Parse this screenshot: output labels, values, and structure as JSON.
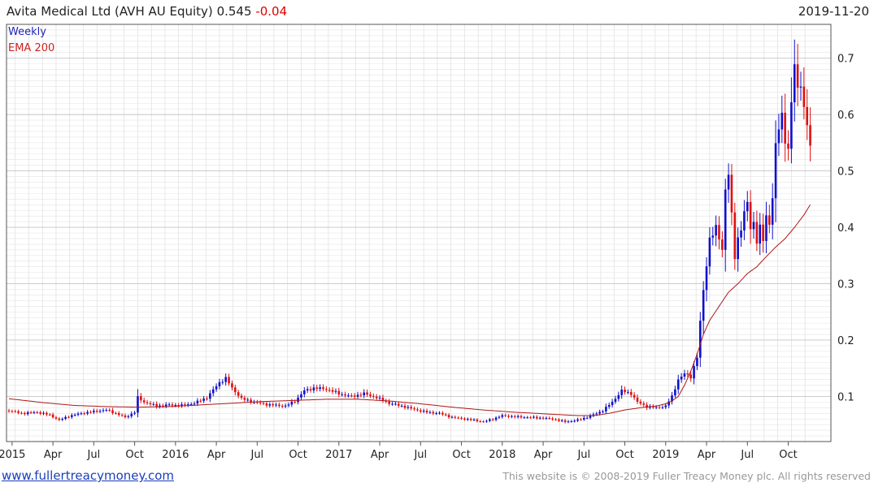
{
  "header": {
    "title": "Avita Medical Ltd (AVH AU Equity)",
    "last_price": "0.545",
    "change": "-0.04",
    "date": "2019-11-20"
  },
  "legend": {
    "series1": "Weekly",
    "series2": "EMA 200"
  },
  "footer": {
    "url": "www.fullertreacymoney.com",
    "copyright": "This website is © 2008-2019 Fuller Treacy Money plc. All rights reserved"
  },
  "colors": {
    "up": "#1010cc",
    "down": "#e01010",
    "ema": "#b01515",
    "grid": "#d8d8d8"
  },
  "chart_data": {
    "type": "candlestick",
    "frequency": "weekly",
    "ylim": [
      0.02,
      0.76
    ],
    "y_ticks": [
      0.1,
      0.2,
      0.3,
      0.4,
      0.5,
      0.6,
      0.7
    ],
    "y_tick_labels": [
      "0.1",
      "0.2",
      "0.3",
      "0.4",
      "0.5",
      "0.6",
      "0.7"
    ],
    "x_tick_labels": [
      "2015",
      "Apr",
      "Jul",
      "Oct",
      "2016",
      "Apr",
      "Jul",
      "Oct",
      "2017",
      "Apr",
      "Jul",
      "Oct",
      "2018",
      "Apr",
      "Jul",
      "Oct",
      "2019",
      "Apr",
      "Jul",
      "Oct"
    ],
    "x_tick_weeks": [
      0,
      13,
      26,
      39,
      52,
      65,
      78,
      91,
      104,
      117,
      130,
      143,
      156,
      169,
      182,
      195,
      208,
      221,
      234,
      247
    ],
    "grid": true,
    "weekly_close_anchors": [
      [
        -1,
        0.075
      ],
      [
        3,
        0.07
      ],
      [
        8,
        0.072
      ],
      [
        12,
        0.067
      ],
      [
        15,
        0.058
      ],
      [
        18,
        0.065
      ],
      [
        22,
        0.07
      ],
      [
        27,
        0.074
      ],
      [
        30,
        0.076
      ],
      [
        33,
        0.07
      ],
      [
        36,
        0.063
      ],
      [
        39,
        0.072
      ],
      [
        40,
        0.098
      ],
      [
        42,
        0.09
      ],
      [
        46,
        0.083
      ],
      [
        50,
        0.085
      ],
      [
        54,
        0.084
      ],
      [
        58,
        0.088
      ],
      [
        62,
        0.098
      ],
      [
        66,
        0.125
      ],
      [
        68,
        0.132
      ],
      [
        70,
        0.115
      ],
      [
        73,
        0.096
      ],
      [
        77,
        0.09
      ],
      [
        82,
        0.085
      ],
      [
        87,
        0.083
      ],
      [
        90,
        0.092
      ],
      [
        93,
        0.11
      ],
      [
        96,
        0.115
      ],
      [
        100,
        0.113
      ],
      [
        104,
        0.105
      ],
      [
        108,
        0.1
      ],
      [
        112,
        0.105
      ],
      [
        116,
        0.098
      ],
      [
        120,
        0.088
      ],
      [
        124,
        0.083
      ],
      [
        128,
        0.077
      ],
      [
        132,
        0.072
      ],
      [
        136,
        0.07
      ],
      [
        140,
        0.063
      ],
      [
        144,
        0.06
      ],
      [
        147,
        0.058
      ],
      [
        150,
        0.055
      ],
      [
        153,
        0.06
      ],
      [
        156,
        0.066
      ],
      [
        160,
        0.064
      ],
      [
        164,
        0.063
      ],
      [
        168,
        0.062
      ],
      [
        172,
        0.06
      ],
      [
        176,
        0.055
      ],
      [
        180,
        0.058
      ],
      [
        184,
        0.065
      ],
      [
        188,
        0.075
      ],
      [
        191,
        0.09
      ],
      [
        194,
        0.11
      ],
      [
        197,
        0.105
      ],
      [
        199,
        0.09
      ],
      [
        202,
        0.082
      ],
      [
        205,
        0.08
      ],
      [
        208,
        0.083
      ],
      [
        210,
        0.1
      ],
      [
        212,
        0.13
      ],
      [
        214,
        0.14
      ],
      [
        216,
        0.135
      ],
      [
        218,
        0.17
      ],
      [
        219,
        0.23
      ],
      [
        220,
        0.29
      ],
      [
        221,
        0.335
      ],
      [
        222,
        0.38
      ],
      [
        224,
        0.395
      ],
      [
        225,
        0.385
      ],
      [
        226,
        0.36
      ],
      [
        227,
        0.47
      ],
      [
        228,
        0.49
      ],
      [
        229,
        0.42
      ],
      [
        230,
        0.35
      ],
      [
        231,
        0.38
      ],
      [
        232,
        0.4
      ],
      [
        233,
        0.42
      ],
      [
        234,
        0.445
      ],
      [
        235,
        0.4
      ],
      [
        236,
        0.41
      ],
      [
        237,
        0.375
      ],
      [
        238,
        0.395
      ],
      [
        239,
        0.38
      ],
      [
        240,
        0.42
      ],
      [
        241,
        0.41
      ],
      [
        242,
        0.45
      ],
      [
        243,
        0.54
      ],
      [
        244,
        0.58
      ],
      [
        245,
        0.6
      ],
      [
        246,
        0.56
      ],
      [
        247,
        0.53
      ],
      [
        248,
        0.62
      ],
      [
        249,
        0.69
      ],
      [
        250,
        0.65
      ],
      [
        251,
        0.66
      ],
      [
        252,
        0.6
      ],
      [
        253,
        0.585
      ],
      [
        254,
        0.545
      ]
    ],
    "ema200_anchors": [
      [
        -1,
        0.096
      ],
      [
        10,
        0.089
      ],
      [
        20,
        0.084
      ],
      [
        30,
        0.082
      ],
      [
        40,
        0.081
      ],
      [
        50,
        0.082
      ],
      [
        60,
        0.085
      ],
      [
        70,
        0.088
      ],
      [
        80,
        0.091
      ],
      [
        90,
        0.093
      ],
      [
        100,
        0.095
      ],
      [
        110,
        0.095
      ],
      [
        120,
        0.092
      ],
      [
        130,
        0.087
      ],
      [
        140,
        0.081
      ],
      [
        150,
        0.076
      ],
      [
        160,
        0.072
      ],
      [
        170,
        0.069
      ],
      [
        180,
        0.066
      ],
      [
        185,
        0.066
      ],
      [
        190,
        0.07
      ],
      [
        195,
        0.076
      ],
      [
        200,
        0.08
      ],
      [
        205,
        0.083
      ],
      [
        208,
        0.087
      ],
      [
        210,
        0.092
      ],
      [
        212,
        0.1
      ],
      [
        214,
        0.12
      ],
      [
        216,
        0.145
      ],
      [
        218,
        0.175
      ],
      [
        220,
        0.21
      ],
      [
        222,
        0.235
      ],
      [
        225,
        0.26
      ],
      [
        228,
        0.285
      ],
      [
        231,
        0.3
      ],
      [
        234,
        0.318
      ],
      [
        237,
        0.33
      ],
      [
        240,
        0.348
      ],
      [
        243,
        0.365
      ],
      [
        246,
        0.38
      ],
      [
        249,
        0.4
      ],
      [
        252,
        0.422
      ],
      [
        254,
        0.44
      ]
    ]
  }
}
